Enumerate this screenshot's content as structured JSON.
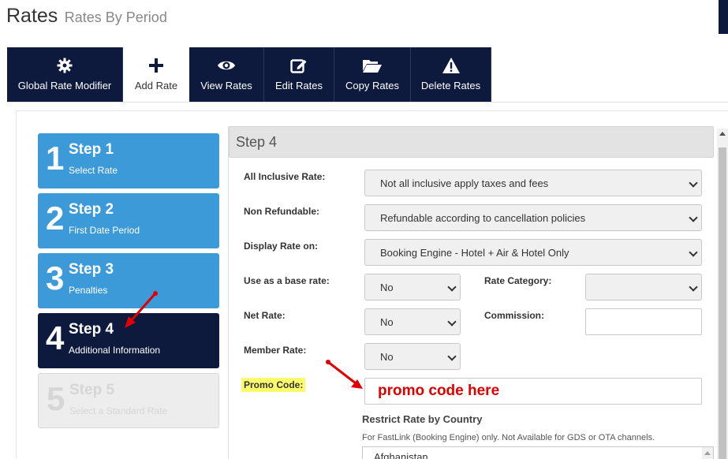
{
  "header": {
    "title": "Rates",
    "subtitle": "Rates By Period"
  },
  "tabs": [
    {
      "label": "Global Rate Modifier",
      "icon": "gear-icon"
    },
    {
      "label": "Add Rate",
      "icon": "plus-icon",
      "active": true
    },
    {
      "label": "View Rates",
      "icon": "eye-icon"
    },
    {
      "label": "Edit Rates",
      "icon": "edit-icon"
    },
    {
      "label": "Copy Rates",
      "icon": "folder-open-icon"
    },
    {
      "label": "Delete Rates",
      "icon": "warning-icon"
    }
  ],
  "steps": [
    {
      "number": "1",
      "title": "Step 1",
      "subtitle": "Select Rate",
      "state": "complete"
    },
    {
      "number": "2",
      "title": "Step 2",
      "subtitle": "First Date Period",
      "state": "complete"
    },
    {
      "number": "3",
      "title": "Step 3",
      "subtitle": "Penalties",
      "state": "complete"
    },
    {
      "number": "4",
      "title": "Step 4",
      "subtitle": "Additional Information",
      "state": "active"
    },
    {
      "number": "5",
      "title": "Step 5",
      "subtitle": "Select a Standard Rate",
      "state": "disabled"
    }
  ],
  "panel": {
    "title": "Step 4"
  },
  "form": {
    "all_inclusive": {
      "label": "All Inclusive Rate:",
      "value": "Not all inclusive apply taxes and fees"
    },
    "non_refundable": {
      "label": "Non Refundable:",
      "value": "Refundable according to cancellation policies"
    },
    "display_rate_on": {
      "label": "Display Rate on:",
      "value": "Booking Engine - Hotel + Air & Hotel Only"
    },
    "base_rate": {
      "label": "Use as a base rate:",
      "value": "No"
    },
    "rate_category": {
      "label": "Rate Category:",
      "value": ""
    },
    "net_rate": {
      "label": "Net Rate:",
      "value": "No"
    },
    "commission": {
      "label": "Commission:",
      "value": ""
    },
    "member_rate": {
      "label": "Member Rate:",
      "value": "No"
    },
    "promo_code": {
      "label": "Promo Code:",
      "value": "promo code here"
    },
    "restrict_country": {
      "title": "Restrict Rate by Country",
      "note": "For FastLink (Booking Engine) only. Not Available for GDS or OTA channels.",
      "first_option": "Afghanistan"
    }
  },
  "colors": {
    "navy": "#0e1a3d",
    "step_blue": "#3d9ad8",
    "annotation_red": "#e00000",
    "highlight_yellow": "#fbfb6c"
  }
}
